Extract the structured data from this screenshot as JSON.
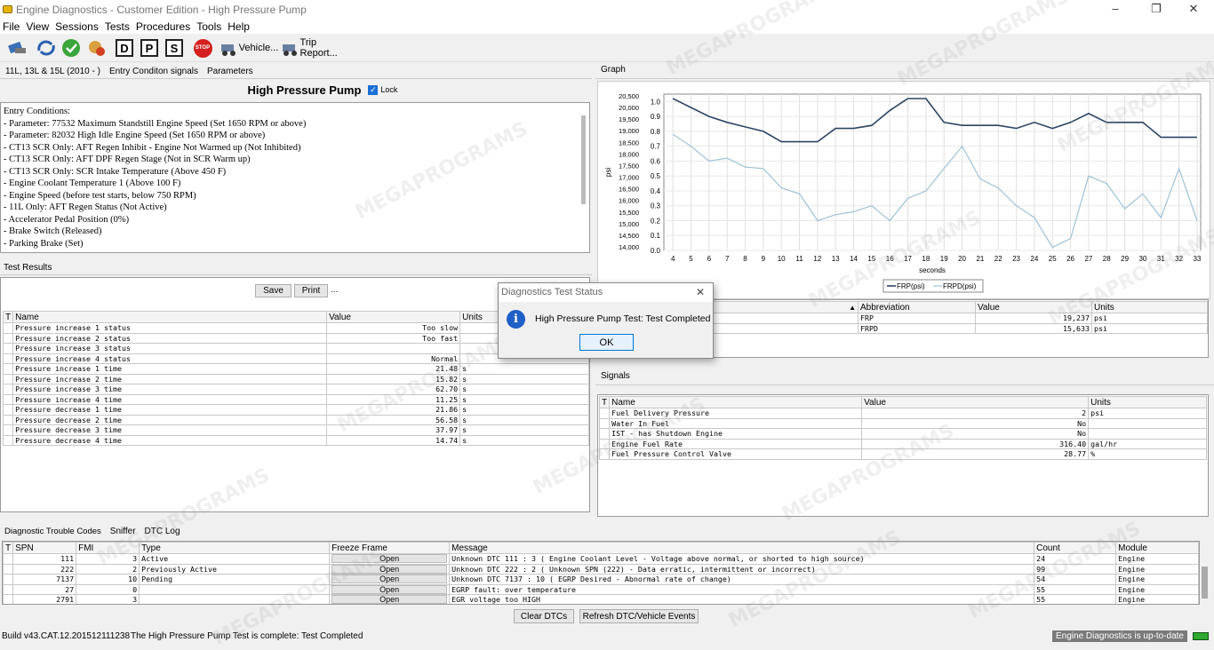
{
  "window": {
    "title": "Engine Diagnostics - Customer Edition - High Pressure Pump",
    "min": "–",
    "max": "❐",
    "close": "✕"
  },
  "menu": [
    "File",
    "View",
    "Sessions",
    "Tests",
    "Procedures",
    "Tools",
    "Help"
  ],
  "toolbar": {
    "d": "D",
    "p": "P",
    "s": "S",
    "stop": "STOP",
    "vehicle": "Vehicle...",
    "trip": "Trip Report..."
  },
  "left": {
    "tabs": [
      "11L, 13L & 15L (2010 - )",
      "Entry Conditon signals",
      "Parameters"
    ],
    "heading": "High Pressure Pump",
    "lock_label": "Lock",
    "entry": [
      "Entry Conditions:",
      "- Parameter: 77532 Maximum Standstill Engine Speed (Set 1650 RPM or above)",
      "- Parameter: 82032 High Idle Engine Speed (Set 1650 RPM or above)",
      "- CT13 SCR Only: AFT Regen Inhibit - Engine Not Warmed up (Not Inhibited)",
      "- CT13 SCR Only: AFT DPF Regen Stage (Not in SCR Warm up)",
      "- CT13 SCR Only: SCR Intake Temperature (Above 450 F)",
      "- Engine Coolant Temperature 1 (Above 100 F)",
      "- Engine Speed (before test starts, below 750 RPM)",
      "- 11L Only: AFT Regen Status (Not Active)",
      "- Accelerator Pedal Position (0%)",
      "- Brake Switch (Released)",
      "- Parking Brake (Set)"
    ],
    "results_tab": "Test Results",
    "save": "Save",
    "print": "Print",
    "more": "...",
    "results_headers": [
      "T",
      "Name",
      "Value",
      "Units"
    ],
    "results": [
      [
        "Pressure increase 1 status",
        "Too slow",
        ""
      ],
      [
        "Pressure increase 2 status",
        "Too fast",
        ""
      ],
      [
        "Pressure increase 3 status",
        "",
        ""
      ],
      [
        "Pressure increase 4 status",
        "Normal",
        ""
      ],
      [
        "Pressure increase 1 time",
        "21.48",
        "s"
      ],
      [
        "Pressure increase 2 time",
        "15.82",
        "s"
      ],
      [
        "Pressure increase 3 time",
        "62.70",
        "s"
      ],
      [
        "Pressure increase 4 time",
        "11.25",
        "s"
      ],
      [
        "Pressure decrease 1 time",
        "21.86",
        "s"
      ],
      [
        "Pressure decrease 2 time",
        "56.58",
        "s"
      ],
      [
        "Pressure decrease 3 time",
        "37.97",
        "s"
      ],
      [
        "Pressure decrease 4 time",
        "14.74",
        "s"
      ]
    ]
  },
  "graph": {
    "tab": "Graph",
    "legend": [
      "FRP(psi)",
      "FRPD(psi)"
    ],
    "chart_data": {
      "type": "line",
      "xlabel": "seconds",
      "ylabel": "psi",
      "x": [
        4,
        5,
        6,
        7,
        8,
        9,
        10,
        11,
        12,
        13,
        14,
        15,
        16,
        17,
        18,
        19,
        20,
        21,
        22,
        23,
        24,
        25,
        26,
        27,
        28,
        29,
        30,
        31,
        32,
        33
      ],
      "yticks_left": [
        "20,500",
        "20,000",
        "19,500",
        "19,000",
        "18,500",
        "18,000",
        "17,500",
        "17,000",
        "16,500",
        "16,000",
        "15,500",
        "15,000",
        "14,500",
        "14,000"
      ],
      "yticks_right": [
        "1.0",
        "0.9",
        "0.8",
        "0.7",
        "0.6",
        "0.5",
        "0.4",
        "0.3",
        "0.2",
        "0.1",
        "0.0"
      ],
      "series": [
        {
          "name": "FRP(psi)",
          "color": "#2b4464",
          "values": [
            1.02,
            0.96,
            0.9,
            0.86,
            0.83,
            0.8,
            0.73,
            0.73,
            0.73,
            0.82,
            0.82,
            0.84,
            0.94,
            1.02,
            1.02,
            0.86,
            0.84,
            0.84,
            0.84,
            0.82,
            0.86,
            0.82,
            0.86,
            0.92,
            0.86,
            0.86,
            0.86,
            0.76,
            0.76,
            0.76
          ]
        },
        {
          "name": "FRPD(psi)",
          "color": "#9fc2d8",
          "values": [
            0.78,
            0.7,
            0.6,
            0.62,
            0.56,
            0.55,
            0.42,
            0.38,
            0.2,
            0.24,
            0.26,
            0.3,
            0.2,
            0.35,
            0.4,
            0.55,
            0.7,
            0.48,
            0.42,
            0.3,
            0.22,
            0.02,
            0.08,
            0.5,
            0.45,
            0.28,
            0.38,
            0.22,
            0.55,
            0.2
          ]
        }
      ]
    }
  },
  "params": {
    "headers": [
      "",
      "Abbreviation",
      "Value",
      "Units"
    ],
    "sort": "▲",
    "rows": [
      [
        "",
        "FRP",
        "19,237",
        "psi"
      ],
      [
        "",
        "FRPD",
        "15,633",
        "psi"
      ]
    ]
  },
  "signals": {
    "tab": "Signals",
    "headers": [
      "T",
      "Name",
      "Value",
      "Units"
    ],
    "rows": [
      [
        "Fuel Delivery Pressure",
        "2",
        "psi"
      ],
      [
        "Water In Fuel",
        "No",
        ""
      ],
      [
        "IST - has Shutdown Engine",
        "No",
        ""
      ],
      [
        "Engine Fuel Rate",
        "316.40",
        "gal/hr"
      ],
      [
        "Fuel Pressure Control Valve",
        "28.77",
        "%"
      ]
    ]
  },
  "dtc": {
    "tabs": [
      "Diagnostic Trouble Codes",
      "Sniffer",
      "DTC Log"
    ],
    "headers": [
      "T",
      "SPN",
      "FMI",
      "Type",
      "Freeze Frame",
      "Message",
      "Count",
      "Module"
    ],
    "rows": [
      [
        "111",
        "3",
        "Active",
        "Open",
        "Unknown DTC 111 : 3  ( Engine Coolant Level - Voltage above normal, or shorted to high source)",
        "24",
        "Engine"
      ],
      [
        "222",
        "2",
        "Previously Active",
        "Open",
        "Unknown DTC 222 : 2  ( Unknown SPN (222) - Data erratic, intermittent or incorrect)",
        "99",
        "Engine"
      ],
      [
        "7137",
        "10",
        "Pending",
        "Open",
        "Unknown DTC 7137 : 10  ( EGRP Desired - Abnormal rate of change)",
        "54",
        "Engine"
      ],
      [
        "27",
        "0",
        "",
        "Open",
        "EGRP fault: over temperature",
        "55",
        "Engine"
      ],
      [
        "2791",
        "3",
        "",
        "Open",
        "EGR voltage too HIGH",
        "55",
        "Engine"
      ]
    ],
    "clear": "Clear DTCs",
    "refresh": "Refresh DTC/Vehicle Events"
  },
  "dialog": {
    "title": "Diagnostics Test Status",
    "message": "High Pressure Pump Test: Test Completed",
    "ok": "OK",
    "close": "✕"
  },
  "status": {
    "build": "Build v43.CAT.12.201512111238",
    "message": "The High Pressure Pump Test is complete: Test Completed",
    "update": "Engine Diagnostics is up-to-date"
  },
  "watermark": "MEGAPROGRAMS"
}
